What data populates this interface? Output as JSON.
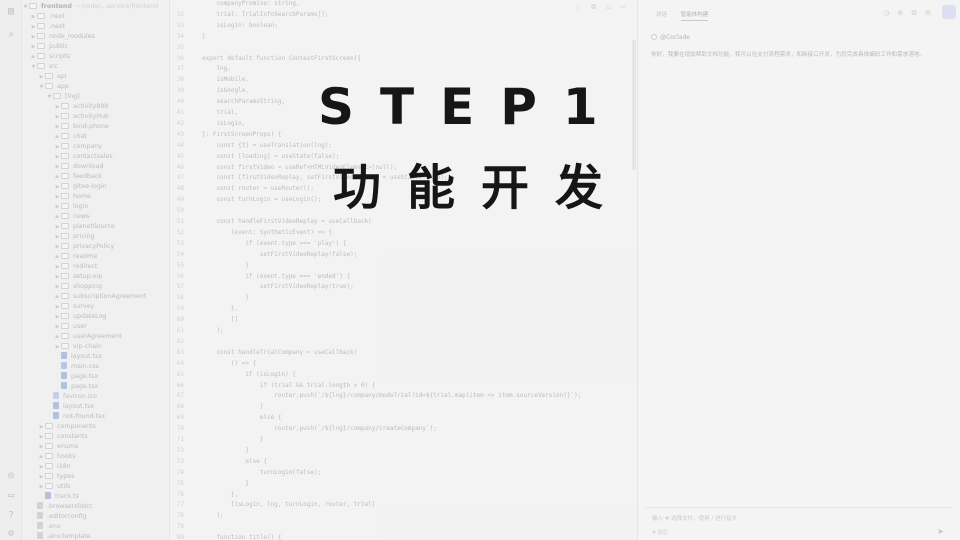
{
  "overlay": {
    "title": "STEP1",
    "subtitle": "功能开发"
  },
  "explorer": {
    "root": "frontend",
    "root_path": "~/code/...service/frontend",
    "items": [
      {
        "label": ".next",
        "depth": 1,
        "kind": "folder",
        "open": false
      },
      {
        "label": ".next",
        "depth": 1,
        "kind": "folder",
        "open": false
      },
      {
        "label": "node_modules",
        "depth": 1,
        "kind": "folder",
        "open": false
      },
      {
        "label": "public",
        "depth": 1,
        "kind": "folder",
        "open": false
      },
      {
        "label": "scripts",
        "depth": 1,
        "kind": "folder",
        "open": false
      },
      {
        "label": "src",
        "depth": 1,
        "kind": "folder",
        "open": true
      },
      {
        "label": "api",
        "depth": 2,
        "kind": "folder",
        "open": false
      },
      {
        "label": "app",
        "depth": 2,
        "kind": "folder",
        "open": true
      },
      {
        "label": "[lng]",
        "depth": 3,
        "kind": "folder",
        "open": true
      },
      {
        "label": "activity898",
        "depth": 4,
        "kind": "folder",
        "open": false
      },
      {
        "label": "activityHub",
        "depth": 4,
        "kind": "folder",
        "open": false
      },
      {
        "label": "bind-phone",
        "depth": 4,
        "kind": "folder",
        "open": false
      },
      {
        "label": "chat",
        "depth": 4,
        "kind": "folder",
        "open": false
      },
      {
        "label": "company",
        "depth": 4,
        "kind": "folder",
        "open": false
      },
      {
        "label": "contactsales",
        "depth": 4,
        "kind": "folder",
        "open": false
      },
      {
        "label": "download",
        "depth": 4,
        "kind": "folder",
        "open": false
      },
      {
        "label": "feedback",
        "depth": 4,
        "kind": "folder",
        "open": false
      },
      {
        "label": "gitee-login",
        "depth": 4,
        "kind": "folder",
        "open": false
      },
      {
        "label": "home",
        "depth": 4,
        "kind": "folder",
        "open": false
      },
      {
        "label": "login",
        "depth": 4,
        "kind": "folder",
        "open": false
      },
      {
        "label": "news",
        "depth": 4,
        "kind": "folder",
        "open": false
      },
      {
        "label": "planetSource",
        "depth": 4,
        "kind": "folder",
        "open": false
      },
      {
        "label": "pricing",
        "depth": 4,
        "kind": "folder",
        "open": false
      },
      {
        "label": "privacyPolicy",
        "depth": 4,
        "kind": "folder",
        "open": false
      },
      {
        "label": "readme",
        "depth": 4,
        "kind": "folder",
        "open": false
      },
      {
        "label": "redirect",
        "depth": 4,
        "kind": "folder",
        "open": false
      },
      {
        "label": "setup-vip",
        "depth": 4,
        "kind": "folder",
        "open": false
      },
      {
        "label": "shopping",
        "depth": 4,
        "kind": "folder",
        "open": false
      },
      {
        "label": "subscriptionAgreement",
        "depth": 4,
        "kind": "folder",
        "open": false
      },
      {
        "label": "survey",
        "depth": 4,
        "kind": "folder",
        "open": false
      },
      {
        "label": "updateLog",
        "depth": 4,
        "kind": "folder",
        "open": false
      },
      {
        "label": "user",
        "depth": 4,
        "kind": "folder",
        "open": false
      },
      {
        "label": "userAgreement",
        "depth": 4,
        "kind": "folder",
        "open": false
      },
      {
        "label": "vip-chain",
        "depth": 4,
        "kind": "folder",
        "open": false
      },
      {
        "label": "layout.tsx",
        "depth": 4,
        "kind": "tsx"
      },
      {
        "label": "main.css",
        "depth": 4,
        "kind": "css"
      },
      {
        "label": "page.tsx",
        "depth": 4,
        "kind": "tsx"
      },
      {
        "label": "page.tsx",
        "depth": 4,
        "kind": "tsx"
      },
      {
        "label": "favicon.ico",
        "depth": 3,
        "kind": "ico"
      },
      {
        "label": "layout.tsx",
        "depth": 3,
        "kind": "tsx"
      },
      {
        "label": "not-found.tsx",
        "depth": 3,
        "kind": "tsx"
      },
      {
        "label": "components",
        "depth": 2,
        "kind": "folder",
        "open": false
      },
      {
        "label": "constants",
        "depth": 2,
        "kind": "folder",
        "open": false
      },
      {
        "label": "enums",
        "depth": 2,
        "kind": "folder",
        "open": false
      },
      {
        "label": "hooks",
        "depth": 2,
        "kind": "folder",
        "open": false
      },
      {
        "label": "i18n",
        "depth": 2,
        "kind": "folder",
        "open": false
      },
      {
        "label": "types",
        "depth": 2,
        "kind": "folder",
        "open": false
      },
      {
        "label": "utils",
        "depth": 2,
        "kind": "folder",
        "open": false
      },
      {
        "label": "track.ts",
        "depth": 2,
        "kind": "ts"
      },
      {
        "label": ".browserslistrc",
        "depth": 1,
        "kind": "cfg"
      },
      {
        "label": ".editorconfig",
        "depth": 1,
        "kind": "cfg"
      },
      {
        "label": ".env",
        "depth": 1,
        "kind": "cfg"
      },
      {
        "label": ".env.template",
        "depth": 1,
        "kind": "cfg"
      }
    ]
  },
  "editor": {
    "toolbar_icons": "⋮ ⧉ ◻ ⋯",
    "lines": [
      {
        "n": "",
        "t": "    companyPromise: string,"
      },
      {
        "n": "32",
        "t": "    trial: TrialInfoSearchParams[];"
      },
      {
        "n": "33",
        "t": "    isLogin: boolean;"
      },
      {
        "n": "34",
        "t": "}"
      },
      {
        "n": "35",
        "t": ""
      },
      {
        "n": "36",
        "t": "export default function ContextFirstScreen({"
      },
      {
        "n": "37",
        "t": "    lng,"
      },
      {
        "n": "38",
        "t": "    isMobile,"
      },
      {
        "n": "39",
        "t": "    isGoogle,"
      },
      {
        "n": "40",
        "t": "    searchParamsString,"
      },
      {
        "n": "41",
        "t": "    trial,"
      },
      {
        "n": "42",
        "t": "    isLogin,"
      },
      {
        "n": "43",
        "t": "}: FirstScreenProps) {"
      },
      {
        "n": "44",
        "t": "    const {t} = useTranslation(lng);"
      },
      {
        "n": "45",
        "t": "    const [loading] = useState(false);"
      },
      {
        "n": "46",
        "t": "    const firstVideo = useRef<HTMLVideoElement>(null);"
      },
      {
        "n": "47",
        "t": "    const [firstVideoReplay, setFirstVideoReplay] = useState(false);"
      },
      {
        "n": "48",
        "t": "    const router = useRouter();"
      },
      {
        "n": "49",
        "t": "    const turnLogin = useLogin();"
      },
      {
        "n": "50",
        "t": ""
      },
      {
        "n": "51",
        "t": "    const handleFirstVideoReplay = useCallback("
      },
      {
        "n": "52",
        "t": "        (event: SyntheticEvent) => {"
      },
      {
        "n": "53",
        "t": "            if (event.type === 'play') {"
      },
      {
        "n": "54",
        "t": "                setFirstVideoReplay(false);"
      },
      {
        "n": "55",
        "t": "            }"
      },
      {
        "n": "56",
        "t": "            if (event.type === 'ended') {"
      },
      {
        "n": "57",
        "t": "                setFirstVideoReplay(true);"
      },
      {
        "n": "58",
        "t": "            }"
      },
      {
        "n": "59",
        "t": "        },"
      },
      {
        "n": "60",
        "t": "        []"
      },
      {
        "n": "61",
        "t": "    );"
      },
      {
        "n": "62",
        "t": ""
      },
      {
        "n": "63",
        "t": "    const handleTrialCompany = useCallback("
      },
      {
        "n": "64",
        "t": "        () => {"
      },
      {
        "n": "65",
        "t": "            if (isLogin) {"
      },
      {
        "n": "66",
        "t": "                if (trial && trial.length > 0) {"
      },
      {
        "n": "67",
        "t": "                    router.push(`/${lng}/company/modeTrial?id=${trial.map(item => item.sourceVersion)}`);"
      },
      {
        "n": "68",
        "t": "                }"
      },
      {
        "n": "69",
        "t": "                else {"
      },
      {
        "n": "70",
        "t": "                    router.push(`/${lng}/company/createCompany`);"
      },
      {
        "n": "71",
        "t": "                }"
      },
      {
        "n": "72",
        "t": "            }"
      },
      {
        "n": "73",
        "t": "            else {"
      },
      {
        "n": "74",
        "t": "                turnLogin(false);"
      },
      {
        "n": "75",
        "t": "            }"
      },
      {
        "n": "76",
        "t": "        },"
      },
      {
        "n": "77",
        "t": "        [isLogin, lng, turnLogin, router, trial]"
      },
      {
        "n": "78",
        "t": "    );"
      },
      {
        "n": "79",
        "t": ""
      },
      {
        "n": "80",
        "t": "    function title() {"
      }
    ]
  },
  "panel": {
    "tabs": [
      "对话",
      "智能体构建"
    ],
    "top_icons": "◷ ⊕ ⧉ ⚙",
    "agent": "@Coclade",
    "reply": "你好，我要在增加帮助文档功能，我可以在支付流程需求，和新接口开发，为您完成具体编码工作和需求落地。",
    "input_placeholder": "输入 # 选择文件，使用 / 进行指令",
    "model": "# 模型",
    "send": "➤"
  }
}
